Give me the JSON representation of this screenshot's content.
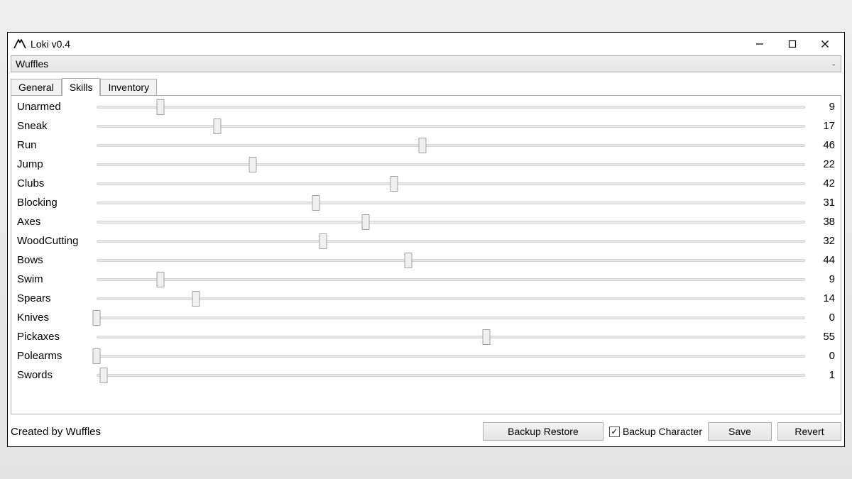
{
  "window": {
    "title": "Loki v0.4"
  },
  "character_select": {
    "value": "Wuffles"
  },
  "tabs": {
    "items": [
      {
        "label": "General",
        "active": false
      },
      {
        "label": "Skills",
        "active": true
      },
      {
        "label": "Inventory",
        "active": false
      }
    ]
  },
  "skills": [
    {
      "name": "Unarmed",
      "value": 9
    },
    {
      "name": "Sneak",
      "value": 17
    },
    {
      "name": "Run",
      "value": 46
    },
    {
      "name": "Jump",
      "value": 22
    },
    {
      "name": "Clubs",
      "value": 42
    },
    {
      "name": "Blocking",
      "value": 31
    },
    {
      "name": "Axes",
      "value": 38
    },
    {
      "name": "WoodCutting",
      "value": 32
    },
    {
      "name": "Bows",
      "value": 44
    },
    {
      "name": "Swim",
      "value": 9
    },
    {
      "name": "Spears",
      "value": 14
    },
    {
      "name": "Knives",
      "value": 0
    },
    {
      "name": "Pickaxes",
      "value": 55
    },
    {
      "name": "Polearms",
      "value": 0
    },
    {
      "name": "Swords",
      "value": 1
    }
  ],
  "slider": {
    "max": 100
  },
  "footer": {
    "credit": "Created by Wuffles",
    "backup_restore": "Backup Restore",
    "backup_character_label": "Backup Character",
    "backup_character_checked": true,
    "save": "Save",
    "revert": "Revert"
  }
}
